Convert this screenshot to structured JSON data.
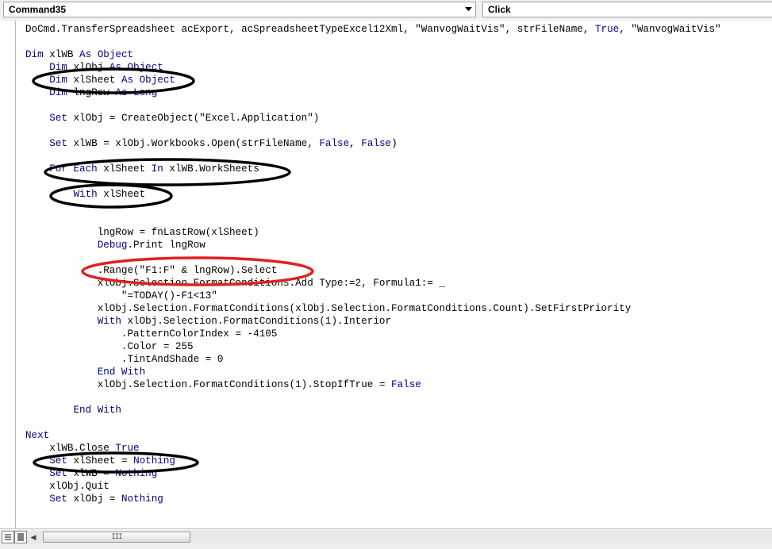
{
  "toolbar": {
    "object_combo": "Command35",
    "procedure_combo": "Click"
  },
  "code_lines": [
    [
      {
        "t": "DoCmd.TransferSpreadsheet acExport, acSpreadsheetTypeExcel12Xml, \"WanvogWaitVis\", strFileName, "
      },
      {
        "t": "True",
        "k": 1
      },
      {
        "t": ", \"WanvogWaitVis\""
      }
    ],
    [],
    [
      {
        "t": "Dim",
        "k": 1
      },
      {
        "t": " xlWB "
      },
      {
        "t": "As Object",
        "k": 1
      }
    ],
    [
      {
        "t": "    "
      },
      {
        "t": "Dim",
        "k": 1
      },
      {
        "t": " xlObj "
      },
      {
        "t": "As Object",
        "k": 1
      }
    ],
    [
      {
        "t": "    "
      },
      {
        "t": "Dim",
        "k": 1
      },
      {
        "t": " xlSheet "
      },
      {
        "t": "As Object",
        "k": 1
      }
    ],
    [
      {
        "t": "    "
      },
      {
        "t": "Dim",
        "k": 1
      },
      {
        "t": " lngRow "
      },
      {
        "t": "As Long",
        "k": 1
      }
    ],
    [],
    [
      {
        "t": "    "
      },
      {
        "t": "Set",
        "k": 1
      },
      {
        "t": " xlObj = CreateObject(\"Excel.Application\")"
      }
    ],
    [],
    [
      {
        "t": "    "
      },
      {
        "t": "Set",
        "k": 1
      },
      {
        "t": " xlWB = xlObj.Workbooks.Open(strFileName, "
      },
      {
        "t": "False",
        "k": 1
      },
      {
        "t": ", "
      },
      {
        "t": "False",
        "k": 1
      },
      {
        "t": ")"
      }
    ],
    [],
    [
      {
        "t": "    "
      },
      {
        "t": "For Each",
        "k": 1
      },
      {
        "t": " xlSheet "
      },
      {
        "t": "In",
        "k": 1
      },
      {
        "t": " xlWB.WorkSheets"
      }
    ],
    [],
    [
      {
        "t": "        "
      },
      {
        "t": "With",
        "k": 1
      },
      {
        "t": " xlSheet"
      }
    ],
    [],
    [],
    [
      {
        "t": "            lngRow = fnLastRow(xlSheet)"
      }
    ],
    [
      {
        "t": "            "
      },
      {
        "t": "Debug",
        "k": 1
      },
      {
        "t": ".Print lngRow"
      }
    ],
    [],
    [
      {
        "t": "            .Range(\"F1:F\" & lngRow).Select"
      }
    ],
    [
      {
        "t": "            xlObj.Selection.FormatConditions.Add Type:=2, Formula1:= _"
      }
    ],
    [
      {
        "t": "                \"=TODAY()-F1<13\""
      }
    ],
    [
      {
        "t": "            xlObj.Selection.FormatConditions(xlObj.Selection.FormatConditions.Count).SetFirstPriority"
      }
    ],
    [
      {
        "t": "            "
      },
      {
        "t": "With",
        "k": 1
      },
      {
        "t": " xlObj.Selection.FormatConditions(1).Interior"
      }
    ],
    [
      {
        "t": "                .PatternColorIndex = -4105"
      }
    ],
    [
      {
        "t": "                .Color = 255"
      }
    ],
    [
      {
        "t": "                .TintAndShade = 0"
      }
    ],
    [
      {
        "t": "            "
      },
      {
        "t": "End With",
        "k": 1
      }
    ],
    [
      {
        "t": "            xlObj.Selection.FormatConditions(1).StopIfTrue = "
      },
      {
        "t": "False",
        "k": 1
      }
    ],
    [],
    [
      {
        "t": "        "
      },
      {
        "t": "End With",
        "k": 1
      }
    ],
    [],
    [
      {
        "t": "Next",
        "k": 1
      }
    ],
    [
      {
        "t": "    xlWB.Close "
      },
      {
        "t": "True",
        "k": 1
      }
    ],
    [
      {
        "t": "    "
      },
      {
        "t": "Set",
        "k": 1
      },
      {
        "t": " xlSheet = "
      },
      {
        "t": "Nothing",
        "k": 1
      }
    ],
    [
      {
        "t": "    "
      },
      {
        "t": "Set",
        "k": 1
      },
      {
        "t": " xlWB = "
      },
      {
        "t": "Nothing",
        "k": 1
      }
    ],
    [
      {
        "t": "    xlObj.Quit"
      }
    ],
    [
      {
        "t": "    "
      },
      {
        "t": "Set",
        "k": 1
      },
      {
        "t": " xlObj = "
      },
      {
        "t": "Nothing",
        "k": 1
      }
    ]
  ],
  "scrollbar": {
    "thumb_grip": "III"
  },
  "colors": {
    "keyword": "#000080",
    "annotation_black": "#000000",
    "annotation_red": "#e02020"
  }
}
